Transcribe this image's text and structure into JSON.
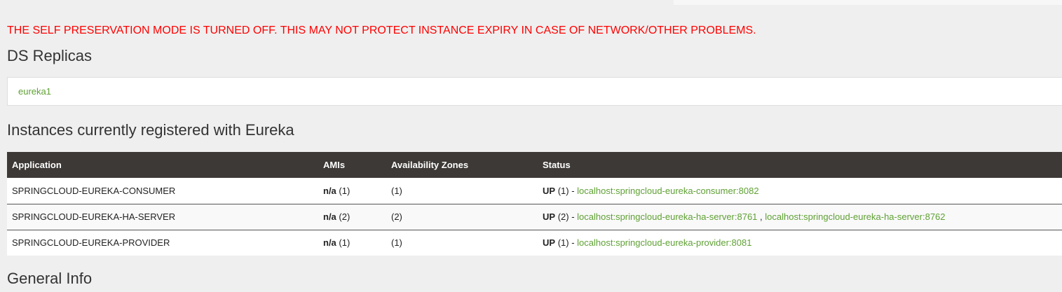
{
  "warning": "THE SELF PRESERVATION MODE IS TURNED OFF. THIS MAY NOT PROTECT INSTANCE EXPIRY IN CASE OF NETWORK/OTHER PROBLEMS.",
  "ds_replicas": {
    "title": "DS Replicas",
    "items": [
      "eureka1"
    ]
  },
  "instances": {
    "title": "Instances currently registered with Eureka",
    "headers": [
      "Application",
      "AMIs",
      "Availability Zones",
      "Status"
    ],
    "rows": [
      {
        "application": "SPRINGCLOUD-EUREKA-CONSUMER",
        "amis_value": "n/a",
        "amis_count": "(1)",
        "zones": "(1)",
        "status": "UP",
        "status_count": "(1) -",
        "links": [
          "localhost:springcloud-eureka-consumer:8082"
        ]
      },
      {
        "application": "SPRINGCLOUD-EUREKA-HA-SERVER",
        "amis_value": "n/a",
        "amis_count": "(2)",
        "zones": "(2)",
        "status": "UP",
        "status_count": "(2) -",
        "links": [
          "localhost:springcloud-eureka-ha-server:8761",
          "localhost:springcloud-eureka-ha-server:8762"
        ]
      },
      {
        "application": "SPRINGCLOUD-EUREKA-PROVIDER",
        "amis_value": "n/a",
        "amis_count": "(1)",
        "zones": "(1)",
        "status": "UP",
        "status_count": "(1) -",
        "links": [
          "localhost:springcloud-eureka-provider:8081"
        ]
      }
    ]
  },
  "general_info": {
    "title": "General Info"
  },
  "colors": {
    "warning": "#ff0000",
    "link": "#5fa134",
    "table_header": "#3d3936"
  }
}
